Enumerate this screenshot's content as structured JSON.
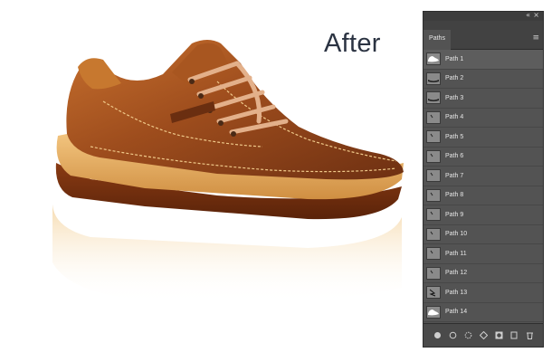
{
  "overlay": {
    "after_label": "After"
  },
  "panel": {
    "tab_label": "Paths",
    "collapse_glyph": "«",
    "close_glyph": "×",
    "menu_glyph": "≡",
    "rows": [
      {
        "label": "Path 1",
        "icon": "shoe-thumb-icon"
      },
      {
        "label": "Path 2",
        "icon": "sole-thumb-icon"
      },
      {
        "label": "Path 3",
        "icon": "sole-thumb-icon"
      },
      {
        "label": "Path 4",
        "icon": "path-thumb-icon"
      },
      {
        "label": "Path 5",
        "icon": "path-thumb-icon"
      },
      {
        "label": "Path 6",
        "icon": "path-thumb-icon"
      },
      {
        "label": "Path 7",
        "icon": "path-thumb-icon"
      },
      {
        "label": "Path 8",
        "icon": "path-thumb-icon"
      },
      {
        "label": "Path 9",
        "icon": "path-thumb-icon"
      },
      {
        "label": "Path 10",
        "icon": "path-thumb-icon"
      },
      {
        "label": "Path 11",
        "icon": "path-thumb-icon"
      },
      {
        "label": "Path 12",
        "icon": "path-thumb-icon"
      },
      {
        "label": "Path 13",
        "icon": "lace-thumb-icon"
      },
      {
        "label": "Path 14",
        "icon": "shoe-thumb-icon"
      }
    ],
    "footer_icons": [
      "fill-path-icon",
      "stroke-path-icon",
      "load-as-selection-icon",
      "make-work-path-icon",
      "add-mask-icon",
      "new-path-icon",
      "delete-path-icon"
    ]
  },
  "colors": {
    "panel_bg": "#535353",
    "leather": "#9a4a1c",
    "sole": "#e0a558",
    "text": "#2b3342"
  }
}
